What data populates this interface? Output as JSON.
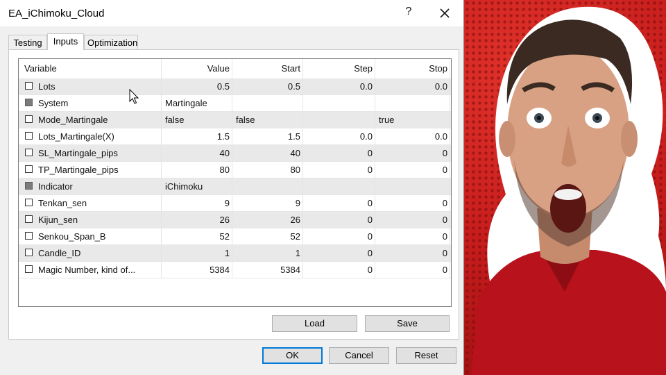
{
  "window": {
    "title": "EA_iChimoku_Cloud",
    "help_label": "?"
  },
  "tabs": [
    {
      "label": "Testing",
      "active": false
    },
    {
      "label": "Inputs",
      "active": true
    },
    {
      "label": "Optimization",
      "active": false
    }
  ],
  "table": {
    "headers": {
      "variable": "Variable",
      "value": "Value",
      "start": "Start",
      "step": "Step",
      "stop": "Stop"
    },
    "rows": [
      {
        "variable": "Lots",
        "value": "0.5",
        "start": "0.5",
        "step": "0.0",
        "stop": "0.0",
        "group": false
      },
      {
        "variable": "System",
        "value": "Martingale",
        "start": "",
        "step": "",
        "stop": "",
        "group": true
      },
      {
        "variable": "Mode_Martingale",
        "value": "false",
        "start": "false",
        "step": "",
        "stop": "true",
        "group": false
      },
      {
        "variable": "Lots_Martingale(X)",
        "value": "1.5",
        "start": "1.5",
        "step": "0.0",
        "stop": "0.0",
        "group": false
      },
      {
        "variable": "SL_Martingale_pips",
        "value": "40",
        "start": "40",
        "step": "0",
        "stop": "0",
        "group": false
      },
      {
        "variable": "TP_Martingale_pips",
        "value": "80",
        "start": "80",
        "step": "0",
        "stop": "0",
        "group": false
      },
      {
        "variable": "Indicator",
        "value": "iChimoku",
        "start": "",
        "step": "",
        "stop": "",
        "group": true
      },
      {
        "variable": "Tenkan_sen",
        "value": "9",
        "start": "9",
        "step": "0",
        "stop": "0",
        "group": false
      },
      {
        "variable": "Kijun_sen",
        "value": "26",
        "start": "26",
        "step": "0",
        "stop": "0",
        "group": false
      },
      {
        "variable": "Senkou_Span_B",
        "value": "52",
        "start": "52",
        "step": "0",
        "stop": "0",
        "group": false
      },
      {
        "variable": "Candle_ID",
        "value": "1",
        "start": "1",
        "step": "0",
        "stop": "0",
        "group": false
      },
      {
        "variable": "Magic Number, kind of...",
        "value": "5384",
        "start": "5384",
        "step": "0",
        "stop": "0",
        "group": false
      }
    ]
  },
  "buttons": {
    "load": "Load",
    "save": "Save",
    "ok": "OK",
    "cancel": "Cancel",
    "reset": "Reset"
  },
  "colors": {
    "photo_background": "#c41b1b",
    "accent": "#0078d7"
  },
  "icons": {
    "close": "close-icon",
    "cursor": "mouse-pointer-icon"
  }
}
